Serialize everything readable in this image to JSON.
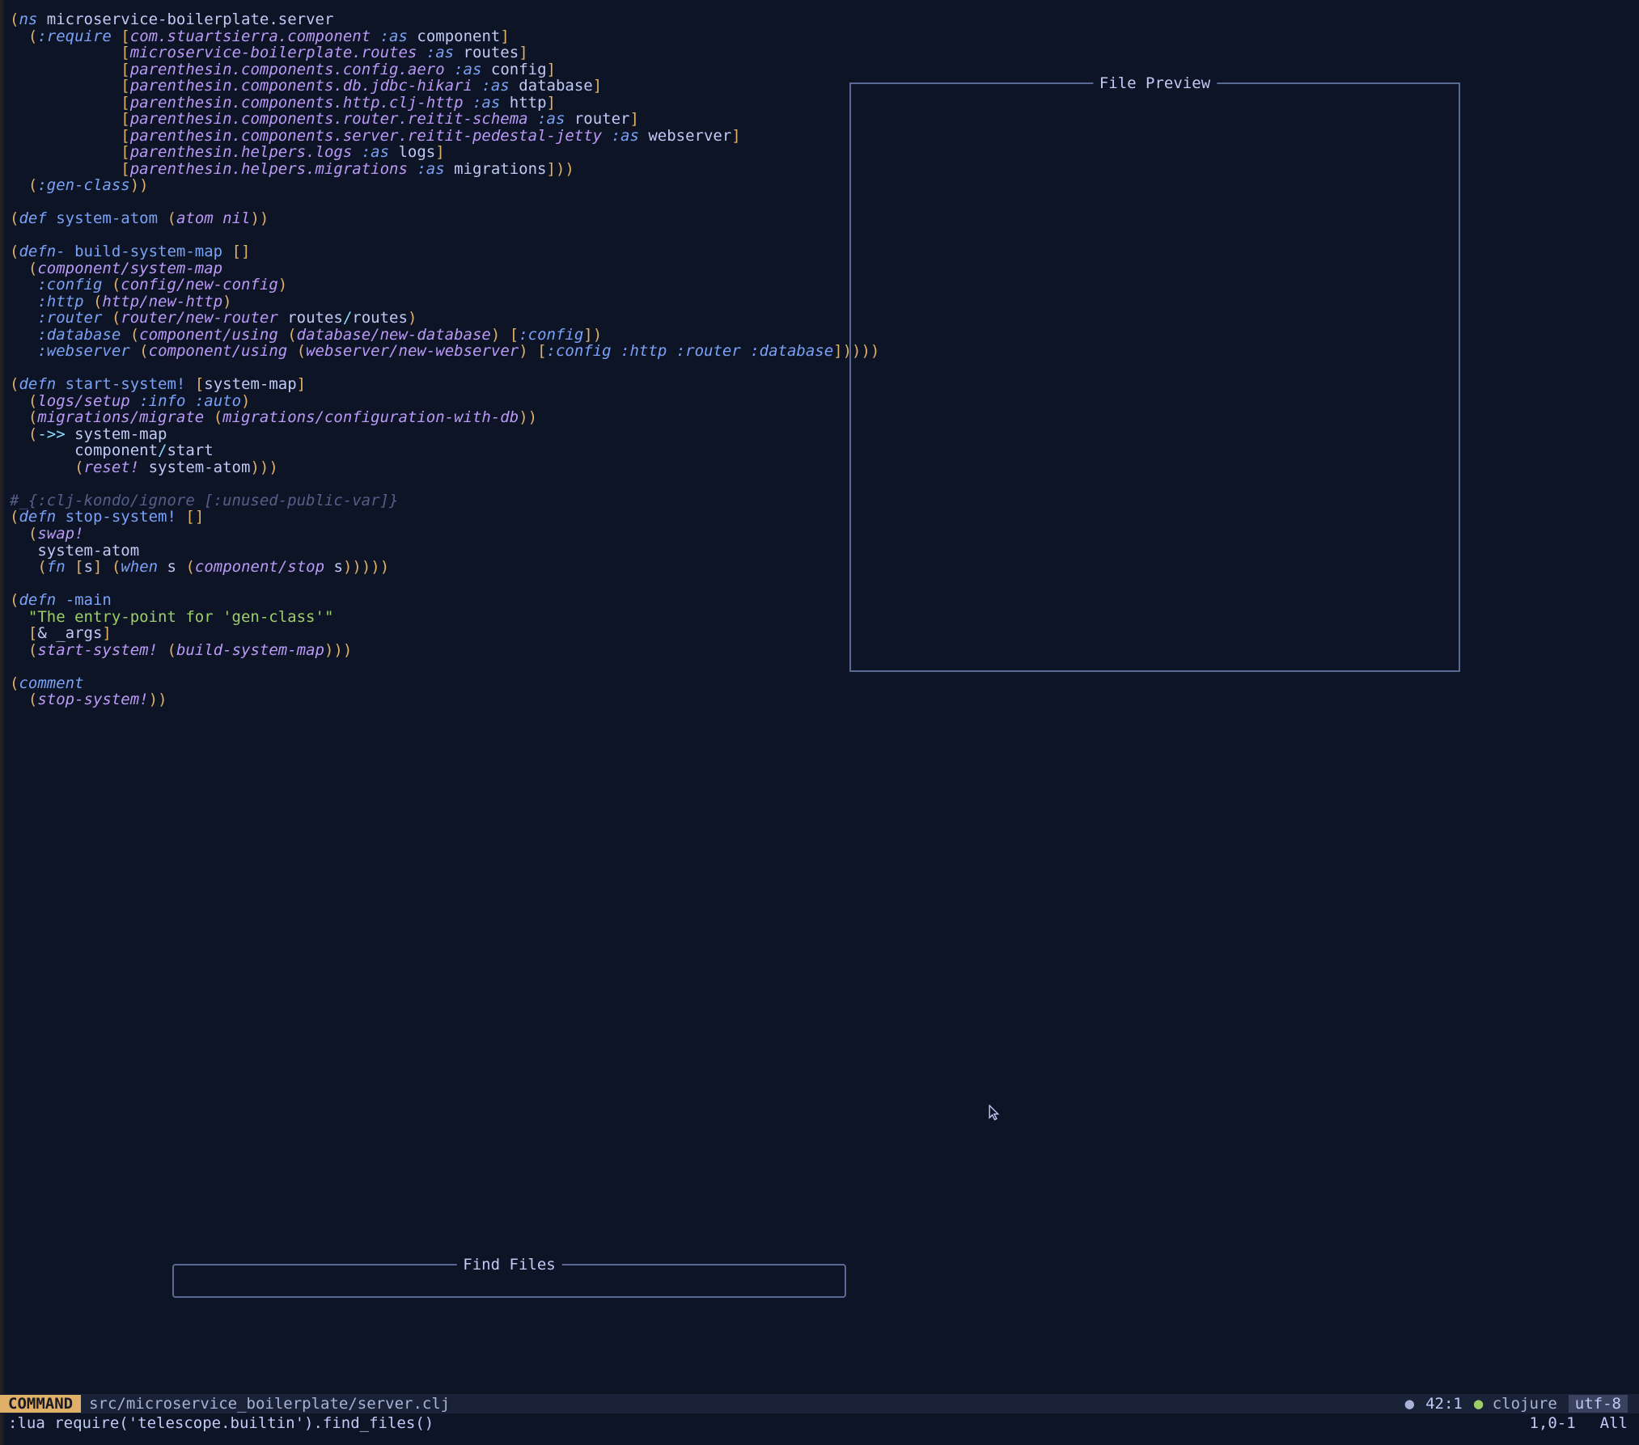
{
  "code": {
    "lines": [
      [
        [
          "p",
          "("
        ],
        [
          "kw",
          "ns "
        ],
        [
          "sym",
          "microservice-boilerplate.server"
        ]
      ],
      [
        [
          "sym",
          "  "
        ],
        [
          "p",
          "("
        ],
        [
          "kw",
          ":require "
        ],
        [
          "p",
          "["
        ],
        [
          "ns",
          "com.stuartsierra.component "
        ],
        [
          "kw",
          ":as "
        ],
        [
          "sym",
          "component"
        ],
        [
          "p",
          "]"
        ]
      ],
      [
        [
          "sym",
          "            "
        ],
        [
          "p",
          "["
        ],
        [
          "ns",
          "microservice-boilerplate.routes "
        ],
        [
          "kw",
          ":as "
        ],
        [
          "sym",
          "routes"
        ],
        [
          "p",
          "]"
        ]
      ],
      [
        [
          "sym",
          "            "
        ],
        [
          "p",
          "["
        ],
        [
          "ns",
          "parenthesin.components.config.aero "
        ],
        [
          "kw",
          ":as "
        ],
        [
          "sym",
          "config"
        ],
        [
          "p",
          "]"
        ]
      ],
      [
        [
          "sym",
          "            "
        ],
        [
          "p",
          "["
        ],
        [
          "ns",
          "parenthesin.components.db.jdbc-hikari "
        ],
        [
          "kw",
          ":as "
        ],
        [
          "sym",
          "database"
        ],
        [
          "p",
          "]"
        ]
      ],
      [
        [
          "sym",
          "            "
        ],
        [
          "p",
          "["
        ],
        [
          "ns",
          "parenthesin.components.http.clj-http "
        ],
        [
          "kw",
          ":as "
        ],
        [
          "sym",
          "http"
        ],
        [
          "p",
          "]"
        ]
      ],
      [
        [
          "sym",
          "            "
        ],
        [
          "p",
          "["
        ],
        [
          "ns",
          "parenthesin.components.router.reitit-schema "
        ],
        [
          "kw",
          ":as "
        ],
        [
          "sym",
          "router"
        ],
        [
          "p",
          "]"
        ]
      ],
      [
        [
          "sym",
          "            "
        ],
        [
          "p",
          "["
        ],
        [
          "ns",
          "parenthesin.components.server.reitit-pedestal-jetty "
        ],
        [
          "kw",
          ":as "
        ],
        [
          "sym",
          "webserver"
        ],
        [
          "p",
          "]"
        ]
      ],
      [
        [
          "sym",
          "            "
        ],
        [
          "p",
          "["
        ],
        [
          "ns",
          "parenthesin.helpers.logs "
        ],
        [
          "kw",
          ":as "
        ],
        [
          "sym",
          "logs"
        ],
        [
          "p",
          "]"
        ]
      ],
      [
        [
          "sym",
          "            "
        ],
        [
          "p",
          "["
        ],
        [
          "ns",
          "parenthesin.helpers.migrations "
        ],
        [
          "kw",
          ":as "
        ],
        [
          "sym",
          "migrations"
        ],
        [
          "p",
          "]))"
        ]
      ],
      [
        [
          "sym",
          "  "
        ],
        [
          "p",
          "("
        ],
        [
          "kw",
          ":gen-class"
        ],
        [
          "p",
          "))"
        ]
      ],
      [
        [
          "sym",
          " "
        ]
      ],
      [
        [
          "p",
          "("
        ],
        [
          "kw",
          "def "
        ],
        [
          "fn",
          "system-atom "
        ],
        [
          "p",
          "("
        ],
        [
          "ns",
          "atom nil"
        ],
        [
          "p",
          "))"
        ]
      ],
      [
        [
          "sym",
          " "
        ]
      ],
      [
        [
          "p",
          "("
        ],
        [
          "kw",
          "defn- "
        ],
        [
          "fn",
          "build-system-map "
        ],
        [
          "p",
          "[]"
        ]
      ],
      [
        [
          "sym",
          "  "
        ],
        [
          "p",
          "("
        ],
        [
          "ns",
          "component/system-map"
        ]
      ],
      [
        [
          "sym",
          "   "
        ],
        [
          "kw",
          ":config "
        ],
        [
          "p",
          "("
        ],
        [
          "ns",
          "config/new-config"
        ],
        [
          "p",
          ")"
        ]
      ],
      [
        [
          "sym",
          "   "
        ],
        [
          "kw",
          ":http "
        ],
        [
          "p",
          "("
        ],
        [
          "ns",
          "http/new-http"
        ],
        [
          "p",
          ")"
        ]
      ],
      [
        [
          "sym",
          "   "
        ],
        [
          "kw",
          ":router "
        ],
        [
          "p",
          "("
        ],
        [
          "ns",
          "router/new-router "
        ],
        [
          "sym",
          "routes"
        ],
        [
          "op",
          "/"
        ],
        [
          "sym",
          "routes"
        ],
        [
          "p",
          ")"
        ]
      ],
      [
        [
          "sym",
          "   "
        ],
        [
          "kw",
          ":database "
        ],
        [
          "p",
          "("
        ],
        [
          "ns",
          "component/using "
        ],
        [
          "p",
          "("
        ],
        [
          "ns",
          "database/new-database"
        ],
        [
          "p",
          ") ["
        ],
        [
          "kw",
          ":config"
        ],
        [
          "p",
          "])"
        ]
      ],
      [
        [
          "sym",
          "   "
        ],
        [
          "kw",
          ":webserver "
        ],
        [
          "p",
          "("
        ],
        [
          "ns",
          "component/using "
        ],
        [
          "p",
          "("
        ],
        [
          "ns",
          "webserver/new-webserver"
        ],
        [
          "p",
          ") ["
        ],
        [
          "kw",
          ":config :http :router :database"
        ],
        [
          "p",
          "]))))"
        ]
      ],
      [
        [
          "sym",
          " "
        ]
      ],
      [
        [
          "p",
          "("
        ],
        [
          "kw",
          "defn "
        ],
        [
          "fn",
          "start-system! "
        ],
        [
          "p",
          "["
        ],
        [
          "sym",
          "system-map"
        ],
        [
          "p",
          "]"
        ]
      ],
      [
        [
          "sym",
          "  "
        ],
        [
          "p",
          "("
        ],
        [
          "ns",
          "logs/setup "
        ],
        [
          "kw",
          ":info :auto"
        ],
        [
          "p",
          ")"
        ]
      ],
      [
        [
          "sym",
          "  "
        ],
        [
          "p",
          "("
        ],
        [
          "ns",
          "migrations/migrate "
        ],
        [
          "p",
          "("
        ],
        [
          "ns",
          "migrations/configuration-with-db"
        ],
        [
          "p",
          "))"
        ]
      ],
      [
        [
          "sym",
          "  "
        ],
        [
          "p",
          "("
        ],
        [
          "op",
          "->> "
        ],
        [
          "sym",
          "system-map"
        ]
      ],
      [
        [
          "sym",
          "       "
        ],
        [
          "sym",
          "component"
        ],
        [
          "op",
          "/"
        ],
        [
          "sym",
          "start"
        ]
      ],
      [
        [
          "sym",
          "       "
        ],
        [
          "p",
          "("
        ],
        [
          "ns",
          "reset! "
        ],
        [
          "sym",
          "system-atom"
        ],
        [
          "p",
          ")))"
        ]
      ],
      [
        [
          "sym",
          " "
        ]
      ],
      [
        [
          "com",
          "#_{:clj-kondo/ignore [:unused-public-var]}"
        ]
      ],
      [
        [
          "p",
          "("
        ],
        [
          "kw",
          "defn "
        ],
        [
          "fn",
          "stop-system! "
        ],
        [
          "p",
          "[]"
        ]
      ],
      [
        [
          "sym",
          "  "
        ],
        [
          "p",
          "("
        ],
        [
          "ns",
          "swap!"
        ]
      ],
      [
        [
          "sym",
          "   "
        ],
        [
          "sym",
          "system-atom"
        ]
      ],
      [
        [
          "sym",
          "   "
        ],
        [
          "p",
          "("
        ],
        [
          "kw",
          "fn "
        ],
        [
          "p",
          "["
        ],
        [
          "sym",
          "s"
        ],
        [
          "p",
          "] ("
        ],
        [
          "kw",
          "when "
        ],
        [
          "sym",
          "s "
        ],
        [
          "p",
          "("
        ],
        [
          "ns",
          "component/stop "
        ],
        [
          "sym",
          "s"
        ],
        [
          "p",
          ")))))"
        ]
      ],
      [
        [
          "sym",
          " "
        ]
      ],
      [
        [
          "p",
          "("
        ],
        [
          "kw",
          "defn "
        ],
        [
          "fn",
          "-main"
        ]
      ],
      [
        [
          "sym",
          "  "
        ],
        [
          "str",
          "\"The entry-point for 'gen-class'\""
        ]
      ],
      [
        [
          "sym",
          "  "
        ],
        [
          "p",
          "["
        ],
        [
          "sym",
          "& _args"
        ],
        [
          "p",
          "]"
        ]
      ],
      [
        [
          "sym",
          "  "
        ],
        [
          "p",
          "("
        ],
        [
          "ns",
          "start-system! "
        ],
        [
          "p",
          "("
        ],
        [
          "ns",
          "build-system-map"
        ],
        [
          "p",
          ")))"
        ]
      ],
      [
        [
          "sym",
          " "
        ]
      ],
      [
        [
          "p",
          "("
        ],
        [
          "kw",
          "comment"
        ]
      ],
      [
        [
          "sym",
          "  "
        ],
        [
          "p",
          "("
        ],
        [
          "ns",
          "stop-system!"
        ],
        [
          "p",
          "))"
        ]
      ]
    ]
  },
  "preview": {
    "title": "File Preview"
  },
  "findfiles": {
    "title": "Find Files",
    "value": ""
  },
  "status": {
    "mode": "COMMAND",
    "path": "src/microservice_boilerplate/server.clj",
    "linecol": "42:1",
    "lang": "clojure",
    "enc": "utf-8"
  },
  "cmdline": {
    "text": ":lua require('telescope.builtin').find_files()",
    "cursorpos": "1,0-1",
    "scroll": "All"
  }
}
